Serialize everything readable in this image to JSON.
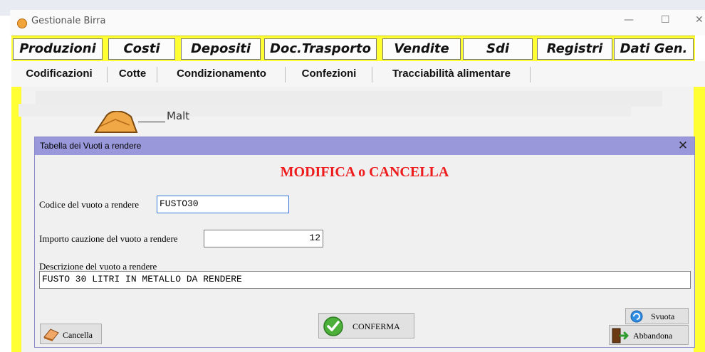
{
  "window": {
    "title": "Gestionale Birra",
    "minimize_glyph": "—",
    "maximize_glyph": "☐",
    "close_glyph": "✕",
    "icon": "app-icon"
  },
  "main_tabs": [
    {
      "label": "Produzioni"
    },
    {
      "label": "Costi"
    },
    {
      "label": "Depositi"
    },
    {
      "label": "Doc.Trasporto"
    },
    {
      "label": "Vendite"
    },
    {
      "label": "Sdi"
    },
    {
      "label": "Registri"
    },
    {
      "label": "Dati Gen."
    }
  ],
  "sub_tabs": [
    {
      "label": "Codificazioni"
    },
    {
      "label": "Cotte"
    },
    {
      "label": "Condizionamento"
    },
    {
      "label": "Confezioni"
    },
    {
      "label": "Tracciabilità alimentare"
    }
  ],
  "background": {
    "diagram_label": "Malt"
  },
  "dialog": {
    "title": "Tabella dei Vuoti a rendere",
    "close_glyph": "✕",
    "heading": "MODIFICA o CANCELLA",
    "code_label": "Codice del vuoto a rendere",
    "code_value": "FUSTO30",
    "deposit_label": "Importo cauzione del vuoto a rendere",
    "deposit_value": "12",
    "description_label": "Descrizione del vuoto a rendere",
    "description_value": "FUSTO 30 LITRI IN METALLO DA RENDERE",
    "buttons": {
      "cancella": "Cancella",
      "conferma": "CONFERMA",
      "svuota": "Svuota",
      "abbandona": "Abbandona"
    }
  },
  "colors": {
    "accent_yellow": "#ffff33",
    "dialog_title_bg": "#9998da",
    "heading_red": "#ee1c1c",
    "confirm_green": "#4caf3a"
  }
}
